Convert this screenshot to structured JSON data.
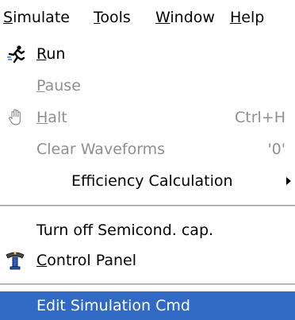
{
  "menubar": {
    "items": [
      {
        "first": "S",
        "rest": "imulate"
      },
      {
        "first": "T",
        "rest": "ools"
      },
      {
        "first": "W",
        "rest": "indow"
      },
      {
        "first": "H",
        "rest": "elp"
      }
    ]
  },
  "menu": {
    "run": {
      "first": "R",
      "rest": "un"
    },
    "pause": {
      "first": "P",
      "rest": "ause"
    },
    "halt": {
      "first": "H",
      "rest": "alt",
      "shortcut": "Ctrl+H"
    },
    "clear_waveforms": {
      "label": "Clear Waveforms",
      "shortcut": "'0'"
    },
    "efficiency_calculation": {
      "label": "Efficiency Calculation"
    },
    "turn_off_semicond_cap": {
      "label": "Turn off Semicond. cap."
    },
    "control_panel": {
      "first": "C",
      "rest": "ontrol Panel"
    },
    "edit_simulation_cmd": {
      "label": "Edit Simulation Cmd"
    }
  },
  "colors": {
    "highlight": "#316ac5",
    "disabled_text": "#8f8f8f"
  },
  "icons": {
    "run": "running-man-icon",
    "halt": "hand-icon",
    "control_panel": "control-panel-icon",
    "submenu": "submenu-arrow-icon"
  }
}
